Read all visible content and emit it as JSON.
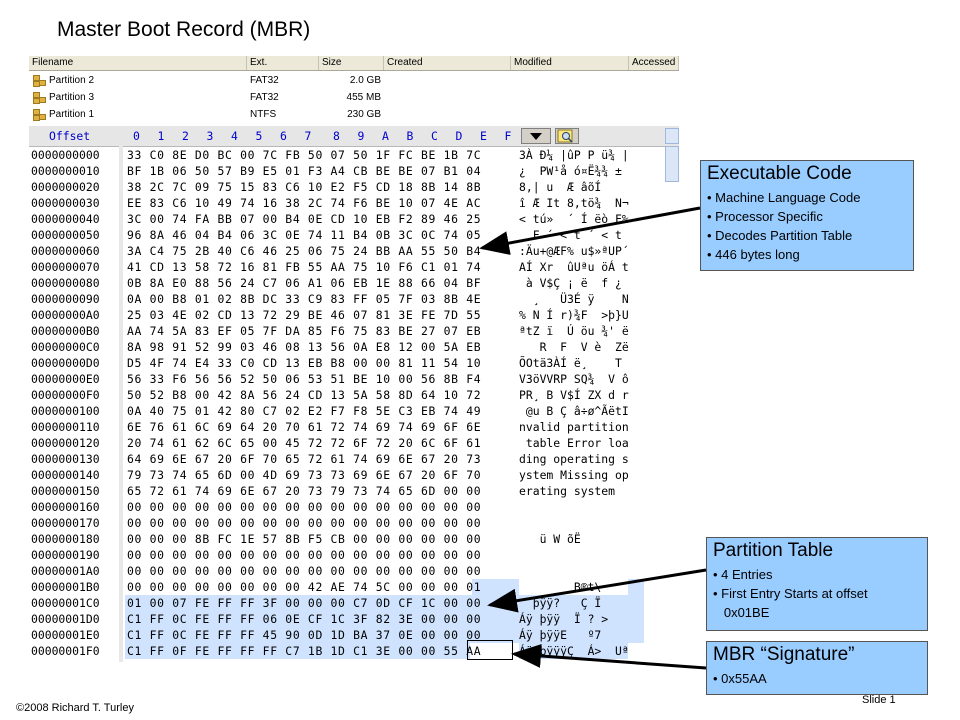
{
  "slide": {
    "title": "Master Boot Record (MBR)",
    "copyright": "©2008 Richard T. Turley",
    "slide_number": "Slide 1"
  },
  "file_list": {
    "columns": [
      "Filename",
      "Ext.",
      "Size",
      "Created",
      "Modified",
      "Accessed"
    ],
    "rows": [
      {
        "name": "Partition 2",
        "ext": "FAT32",
        "size": "2.0 GB"
      },
      {
        "name": "Partition 3",
        "ext": "FAT32",
        "size": "455 MB"
      },
      {
        "name": "Partition 1",
        "ext": "NTFS",
        "size": "230 GB"
      }
    ]
  },
  "hex_view": {
    "offset_label": "Offset",
    "columns": [
      "0",
      "1",
      "2",
      "3",
      "4",
      "5",
      "6",
      "7",
      "8",
      "9",
      "A",
      "B",
      "C",
      "D",
      "E",
      "F"
    ],
    "rows": [
      {
        "off": "0000000000",
        "hex": "33 C0 8E D0 BC 00 7C FB 50 07 50 1F FC BE 1B 7C",
        "asc": "3À Ð¼ |ûP P ü¾ |"
      },
      {
        "off": "0000000010",
        "hex": "BF 1B 06 50 57 B9 E5 01 F3 A4 CB BE BE 07 B1 04",
        "asc": "¿  PW¹å ó¤Ë¾¾ ±"
      },
      {
        "off": "0000000020",
        "hex": "38 2C 7C 09 75 15 83 C6 10 E2 F5 CD 18 8B 14 8B",
        "asc": "8,| u  Æ âõÍ  "
      },
      {
        "off": "0000000030",
        "hex": "EE 83 C6 10 49 74 16 38 2C 74 F6 BE 10 07 4E AC",
        "asc": "î Æ It 8,tö¾  N¬"
      },
      {
        "off": "0000000040",
        "hex": "3C 00 74 FA BB 07 00 B4 0E CD 10 EB F2 89 46 25",
        "asc": "< tú»  ´ Í ëò F%"
      },
      {
        "off": "0000000050",
        "hex": "96 8A 46 04 B4 06 3C 0E 74 11 B4 0B 3C 0C 74 05",
        "asc": "  F ´ < t ´ < t"
      },
      {
        "off": "0000000060",
        "hex": "3A C4 75 2B 40 C6 46 25 06 75 24 BB AA 55 50 B4",
        "asc": ":Äu+@ÆF% u$»ªUP´"
      },
      {
        "off": "0000000070",
        "hex": "41 CD 13 58 72 16 81 FB 55 AA 75 10 F6 C1 01 74",
        "asc": "AÍ Xr  ûUªu öÁ t"
      },
      {
        "off": "0000000080",
        "hex": "0B 8A E0 88 56 24 C7 06 A1 06 EB 1E 88 66 04 BF",
        "asc": " à V$Ç ¡ ë  f ¿"
      },
      {
        "off": "0000000090",
        "hex": "0A 00 B8 01 02 8B DC 33 C9 83 FF 05 7F 03 8B 4E",
        "asc": "  ¸   Ü3É ÿ    N"
      },
      {
        "off": "00000000A0",
        "hex": "25 03 4E 02 CD 13 72 29 BE 46 07 81 3E FE 7D 55",
        "asc": "% N Í r)¾F  >þ}U"
      },
      {
        "off": "00000000B0",
        "hex": "AA 74 5A 83 EF 05 7F DA 85 F6 75 83 BE 27 07 EB",
        "asc": "ªtZ ï  Ú öu ¾' ë"
      },
      {
        "off": "00000000C0",
        "hex": "8A 98 91 52 99 03 46 08 13 56 0A E8 12 00 5A EB",
        "asc": "   R  F  V è  Zë"
      },
      {
        "off": "00000000D0",
        "hex": "D5 4F 74 E4 33 C0 CD 13 EB B8 00 00 81 11 54 10",
        "asc": "ÕOtä3ÀÍ ë¸    T"
      },
      {
        "off": "00000000E0",
        "hex": "56 33 F6 56 56 52 50 06 53 51 BE 10 00 56 8B F4",
        "asc": "V3öVVRP SQ¾  V ô"
      },
      {
        "off": "00000000F0",
        "hex": "50 52 B8 00 42 8A 56 24 CD 13 5A 58 8D 64 10 72",
        "asc": "PR¸ B V$Í ZX d r"
      },
      {
        "off": "0000000100",
        "hex": "0A 40 75 01 42 80 C7 02 E2 F7 F8 5E C3 EB 74 49",
        "asc": " @u B Ç â÷ø^ÃëtI"
      },
      {
        "off": "0000000110",
        "hex": "6E 76 61 6C 69 64 20 70 61 72 74 69 74 69 6F 6E",
        "asc": "nvalid partition"
      },
      {
        "off": "0000000120",
        "hex": "20 74 61 62 6C 65 00 45 72 72 6F 72 20 6C 6F 61",
        "asc": " table Error loa"
      },
      {
        "off": "0000000130",
        "hex": "64 69 6E 67 20 6F 70 65 72 61 74 69 6E 67 20 73",
        "asc": "ding operating s"
      },
      {
        "off": "0000000140",
        "hex": "79 73 74 65 6D 00 4D 69 73 73 69 6E 67 20 6F 70",
        "asc": "ystem Missing op"
      },
      {
        "off": "0000000150",
        "hex": "65 72 61 74 69 6E 67 20 73 79 73 74 65 6D 00 00",
        "asc": "erating system"
      },
      {
        "off": "0000000160",
        "hex": "00 00 00 00 00 00 00 00 00 00 00 00 00 00 00 00",
        "asc": ""
      },
      {
        "off": "0000000170",
        "hex": "00 00 00 00 00 00 00 00 00 00 00 00 00 00 00 00",
        "asc": ""
      },
      {
        "off": "0000000180",
        "hex": "00 00 00 8B FC 1E 57 8B F5 CB 00 00 00 00 00 00",
        "asc": "   ü W õË"
      },
      {
        "off": "0000000190",
        "hex": "00 00 00 00 00 00 00 00 00 00 00 00 00 00 00 00",
        "asc": ""
      },
      {
        "off": "00000001A0",
        "hex": "00 00 00 00 00 00 00 00 00 00 00 00 00 00 00 00",
        "asc": ""
      },
      {
        "off": "00000001B0",
        "hex": "00 00 00 00 00 00 00 00 42 AE 74 5C 00 00 00 01",
        "asc": "        B®t\\"
      },
      {
        "off": "00000001C0",
        "hex": "01 00 07 FE FF FF 3F 00 00 00 C7 0D CF 1C 00 00",
        "asc": "  þÿÿ?   Ç Ï"
      },
      {
        "off": "00000001D0",
        "hex": "C1 FF 0C FE FF FF 06 0E CF 1C 3F 82 3E 00 00 00",
        "asc": "Áÿ þÿÿ  Ï ? >"
      },
      {
        "off": "00000001E0",
        "hex": "C1 FF 0C FE FF FF 45 90 0D 1D BA 37 0E 00 00 00",
        "asc": "Áÿ þÿÿE   º7"
      },
      {
        "off": "00000001F0",
        "hex": "C1 FF 0F FE FF FF FF C7 1B 1D C1 3E 00 00 55 AA",
        "asc": "Áÿ þÿÿÿÇ  Á>  Uª"
      }
    ]
  },
  "callouts": {
    "executable": {
      "title": "Executable Code",
      "bullets": [
        "• Machine Language Code",
        "• Processor Specific",
        "• Decodes Partition Table",
        "• 446 bytes long"
      ],
      "color": "#99ccff"
    },
    "partition": {
      "title": "Partition Table",
      "bullets": [
        "•  4 Entries",
        "•  First Entry Starts at offset",
        "   0x01BE"
      ],
      "color": "#99ccff"
    },
    "signature": {
      "title": "MBR “Signature”",
      "bullets": [
        "• 0x55AA"
      ],
      "color": "#99ccff"
    }
  }
}
